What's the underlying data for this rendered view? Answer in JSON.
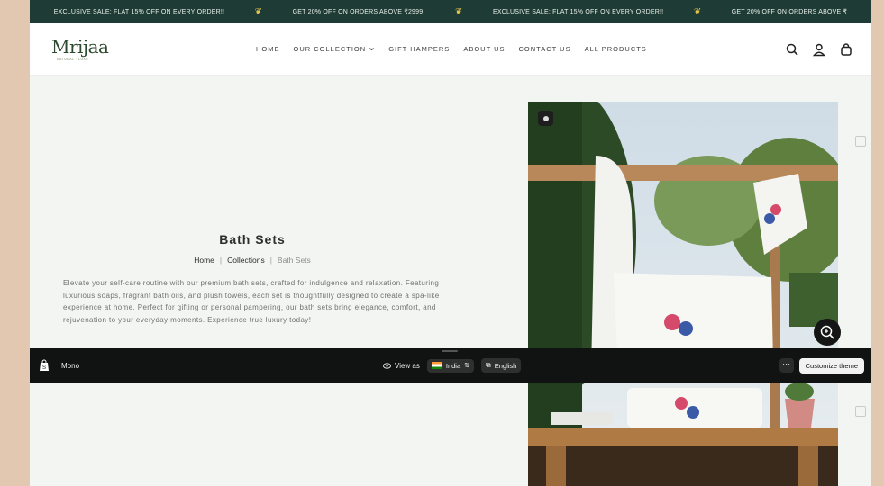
{
  "announcement": {
    "messages": [
      "EXCLUSIVE SALE: FLAT 15% OFF ON EVERY ORDER!!",
      "GET 20% OFF ON ORDERS ABOVE ₹2999!",
      "EXCLUSIVE SALE: FLAT 15% OFF ON EVERY ORDER!!",
      "GET 20% OFF ON ORDERS ABOVE ₹"
    ],
    "separator": "❦"
  },
  "header": {
    "logo_text": "Mrijaa",
    "logo_tagline": "NATURAL · LUXE",
    "nav": [
      "HOME",
      "OUR COLLECTION",
      "GIFT HAMPERS",
      "ABOUT US",
      "CONTACT US",
      "ALL PRODUCTS"
    ],
    "icons": [
      "search-icon",
      "account-icon",
      "bag-icon"
    ]
  },
  "collection": {
    "title": "Bath Sets",
    "breadcrumb": [
      "Home",
      "Collections",
      "Bath Sets"
    ],
    "description": "Elevate your self-care routine with our premium bath sets, crafted for indulgence and relaxation. Featuring luxurious soaps, fragrant bath oils, and plush towels, each set is thoughtfully designed to create a spa-like experience at home. Perfect for gifting or personal pampering, our bath sets bring elegance, comfort, and rejuvenation to your everyday moments. Experience true luxury today!"
  },
  "theme_bar": {
    "theme_name": "Mono",
    "view_as": "View as",
    "country": "India",
    "language": "English",
    "more": "···",
    "customize": "Customize theme"
  },
  "colors": {
    "announcement_bg": "#1e3b35",
    "page_bg": "#f3f5f2",
    "accent_green": "#2e4a2e",
    "theme_bar_bg": "#111212",
    "outer_bg": "#e2c7b1"
  }
}
